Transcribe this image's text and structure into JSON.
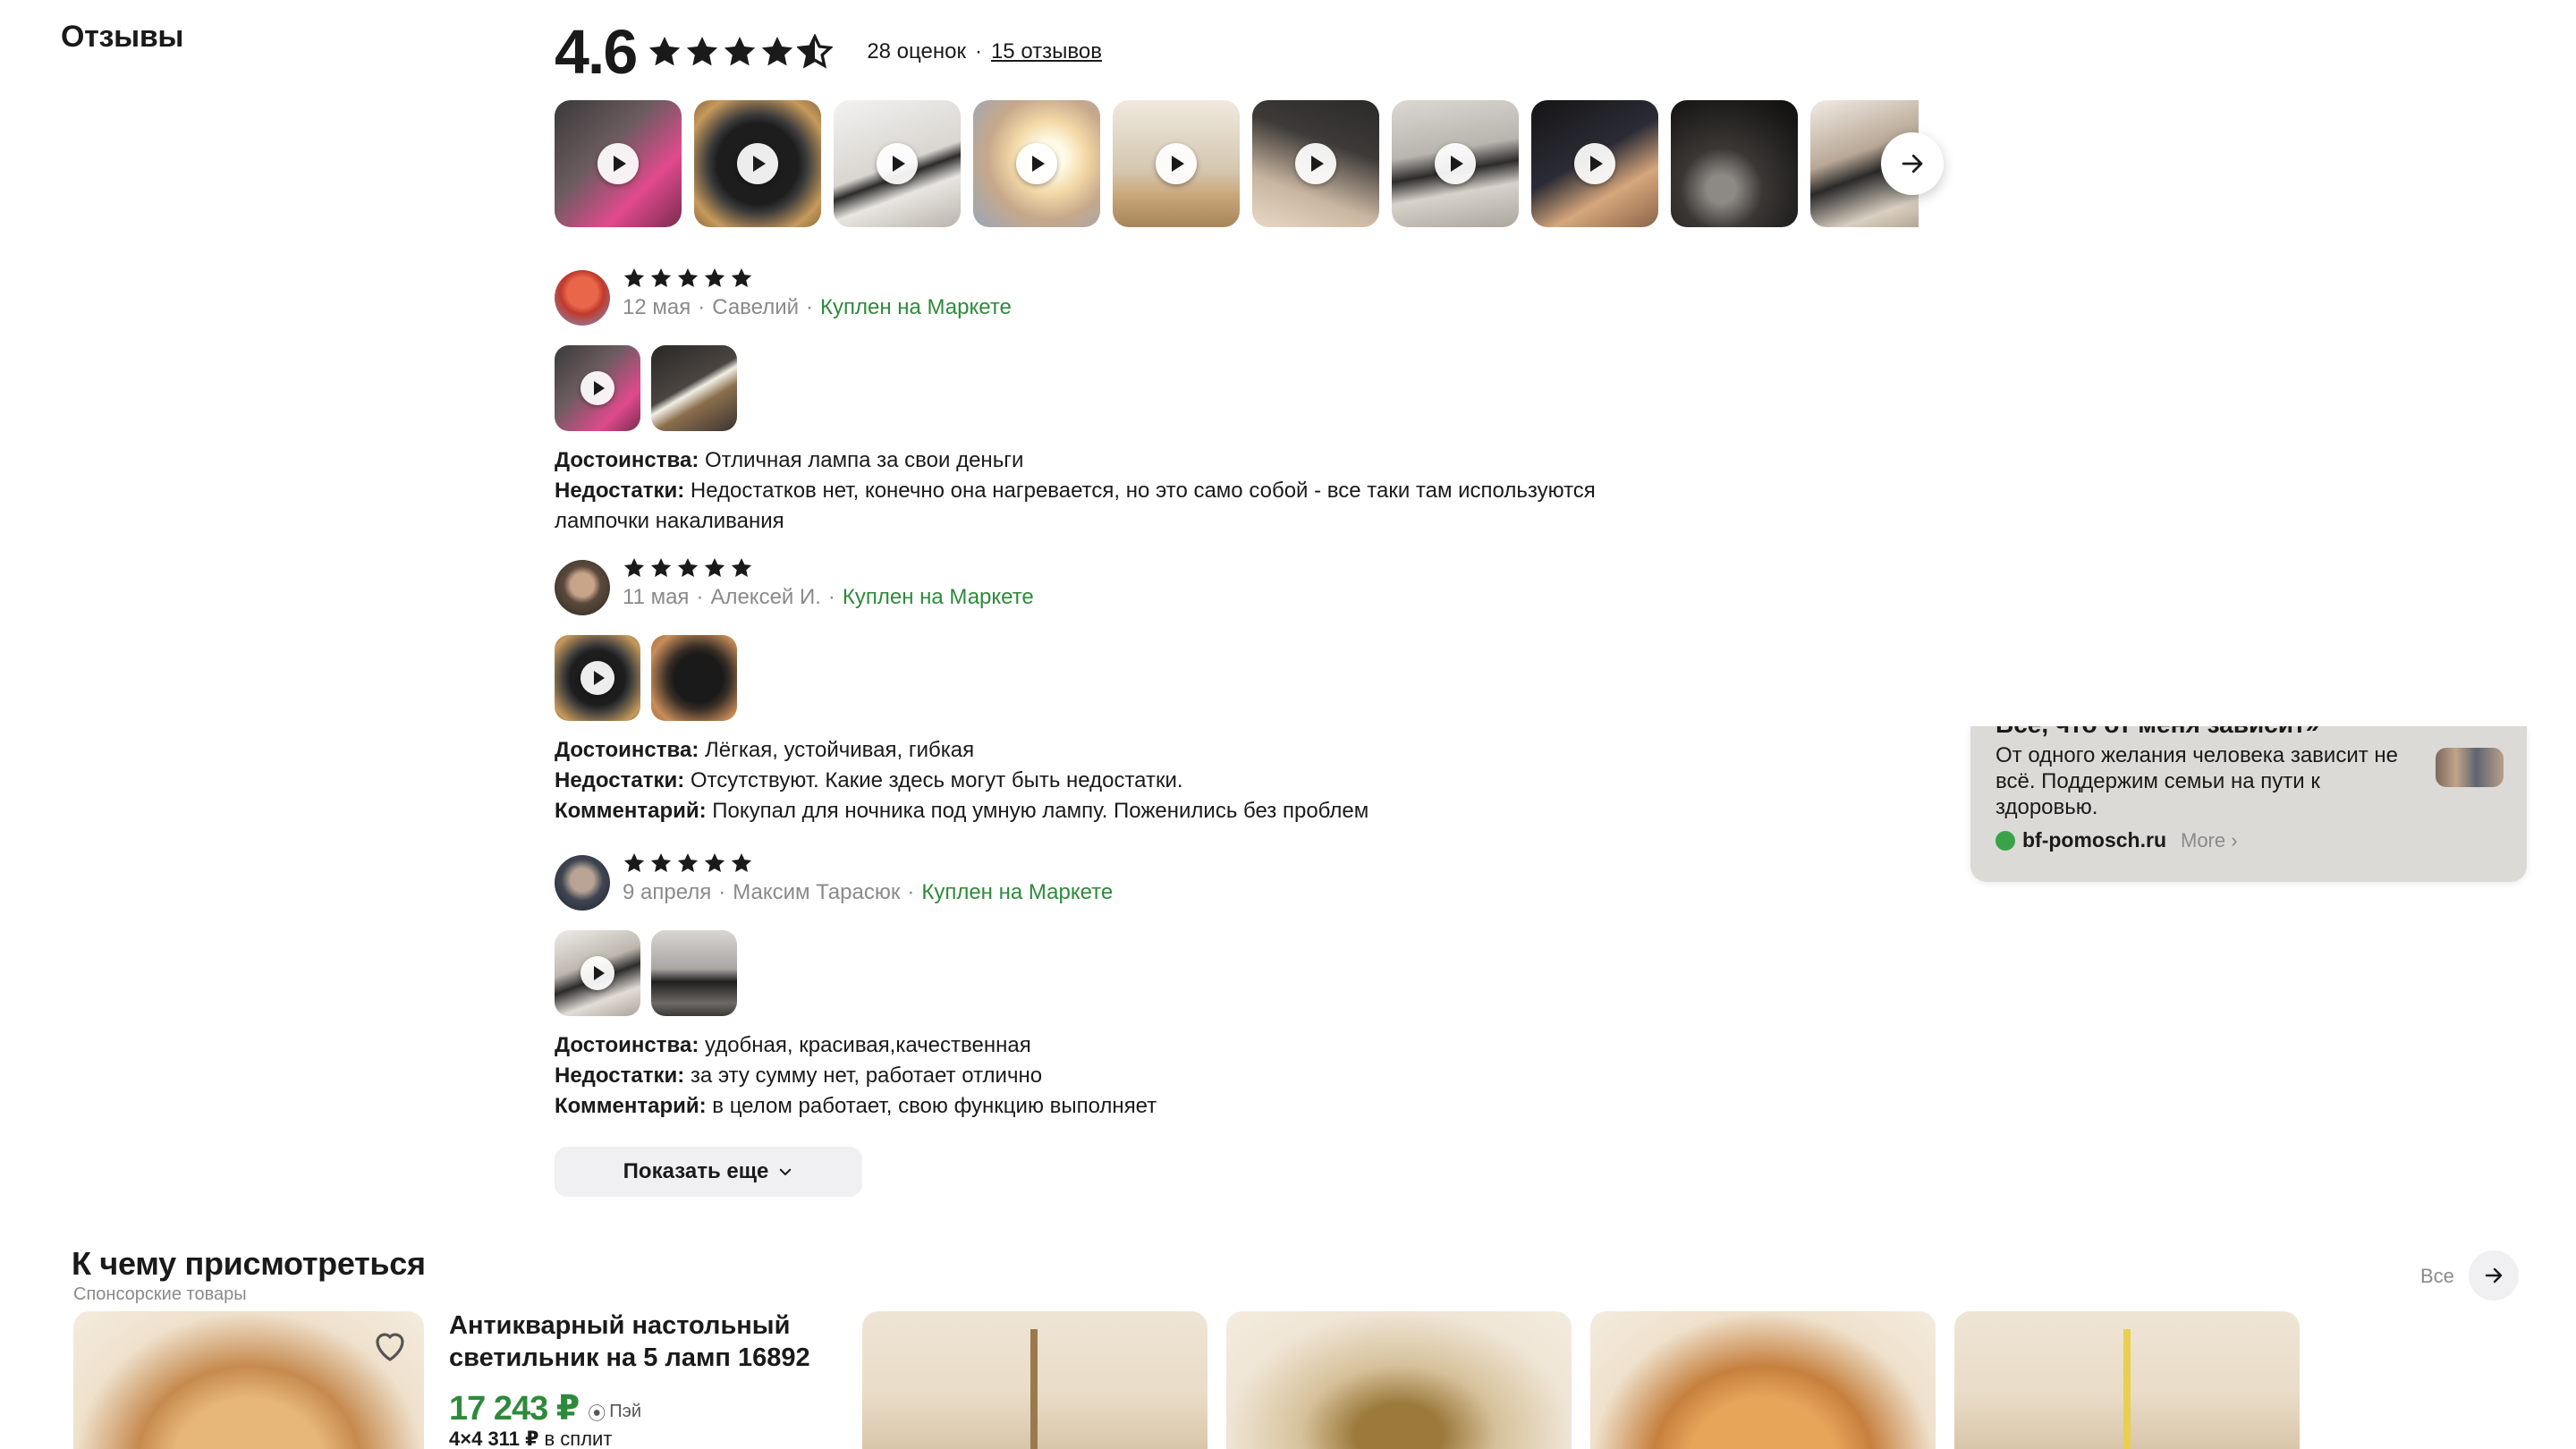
{
  "reviews_section": {
    "heading": "Отзывы",
    "rating": "4.6",
    "ratings_count": "28 оценок",
    "separator": "·",
    "reviews_link": "15 отзывов"
  },
  "reviews": [
    {
      "date": "12 мая",
      "author": "Савелий",
      "bought": "Куплен на Маркете",
      "stars": 5,
      "pros_label": "Достоинства:",
      "pros": "Отличная лампа за свои деньги",
      "cons_label": "Недостатки:",
      "cons": "Недостатков нет, конечно она нагревается, но это само собой - все таки там используются лампочки накаливания"
    },
    {
      "date": "11 мая",
      "author": "Алексей И.",
      "bought": "Куплен на Маркете",
      "stars": 5,
      "pros_label": "Достоинства:",
      "pros": "Лёгкая, устойчивая, гибкая",
      "cons_label": "Недостатки:",
      "cons": "Отсутствуют. Какие здесь могут быть недостатки.",
      "comment_label": "Комментарий:",
      "comment": "Покупал для ночника под умную лампу. Поженились без проблем"
    },
    {
      "date": "9 апреля",
      "author": "Максим Тарасюк",
      "bought": "Куплен на Маркете",
      "stars": 5,
      "pros_label": "Достоинства:",
      "pros": "удобная, красивая,качественная",
      "cons_label": "Недостатки:",
      "cons": "за эту сумму нет, работает отлично",
      "comment_label": "Комментарий:",
      "comment": "в целом работает, свою функцию выполняет"
    }
  ],
  "show_more": "Показать еще",
  "ad": {
    "cut_title": "Всё, что от меня зависит»",
    "text": "От одного желания человека зависит не всё. Поддержим семьи на пути к здоровью.",
    "domain": "bf-pomosch.ru",
    "more": "More"
  },
  "recommendations": {
    "title": "К чему присмотреться",
    "subtitle": "Спонсорские товары",
    "all": "Все",
    "product": {
      "name": "Антикварный настольный светильник на 5 ламп 16892",
      "price": "17 243",
      "currency": "₽",
      "pay": "Пэй",
      "split_prefix": "4×",
      "split_amount": "4 311",
      "split_currency": "₽",
      "split_suffix": "в сплит"
    }
  },
  "colors": {
    "accent_green": "#2e8a3b",
    "muted": "#8a8a8a",
    "button_bg": "#f0f0f2"
  }
}
